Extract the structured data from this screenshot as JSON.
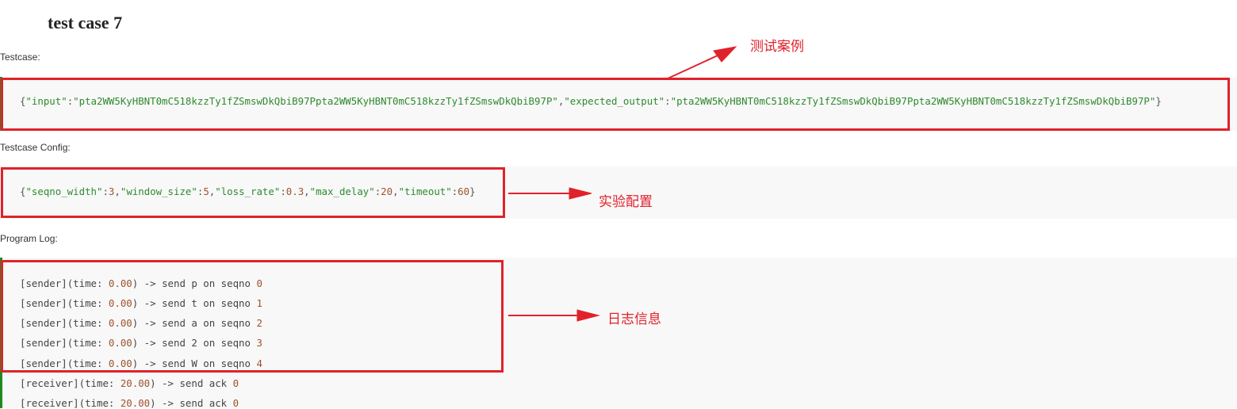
{
  "title": "test case 7",
  "testcase": {
    "label": "Testcase:",
    "input_key": "\"input\"",
    "input_value": "\"pta2WW5KyHBNT0mC518kzzTy1fZSmswDkQbiB97Ppta2WW5KyHBNT0mC518kzzTy1fZSmswDkQbiB97P\"",
    "output_key": "\"expected_output\"",
    "output_value": "\"pta2WW5KyHBNT0mC518kzzTy1fZSmswDkQbiB97Ppta2WW5KyHBNT0mC518kzzTy1fZSmswDkQbiB97P\""
  },
  "config": {
    "label": "Testcase Config:",
    "fields": [
      {
        "key": "\"seqno_width\"",
        "value": "3"
      },
      {
        "key": "\"window_size\"",
        "value": "5"
      },
      {
        "key": "\"loss_rate\"",
        "value": "0.3"
      },
      {
        "key": "\"max_delay\"",
        "value": "20"
      },
      {
        "key": "\"timeout\"",
        "value": "60"
      }
    ]
  },
  "log": {
    "label": "Program Log:",
    "lines": [
      {
        "actor": "[sender]",
        "time": "0.00",
        "action": "send p on seqno",
        "num": "0"
      },
      {
        "actor": "[sender]",
        "time": "0.00",
        "action": "send t on seqno",
        "num": "1"
      },
      {
        "actor": "[sender]",
        "time": "0.00",
        "action": "send a on seqno",
        "num": "2"
      },
      {
        "actor": "[sender]",
        "time": "0.00",
        "action": "send 2 on seqno",
        "num": "3"
      },
      {
        "actor": "[sender]",
        "time": "0.00",
        "action": "send W on seqno",
        "num": "4"
      },
      {
        "actor": "[receiver]",
        "time": "20.00",
        "action": "send ack",
        "num": "0"
      },
      {
        "actor": "[receiver]",
        "time": "20.00",
        "action": "send ack",
        "num": "0"
      }
    ]
  },
  "annotations": {
    "testcase": "测试案例",
    "config": "实验配置",
    "log": "日志信息"
  },
  "colors": {
    "highlight_box": "#e0222b",
    "code_string": "#2f8a2f",
    "code_number": "#a0522d",
    "code_bar": "#1f8a1f"
  }
}
